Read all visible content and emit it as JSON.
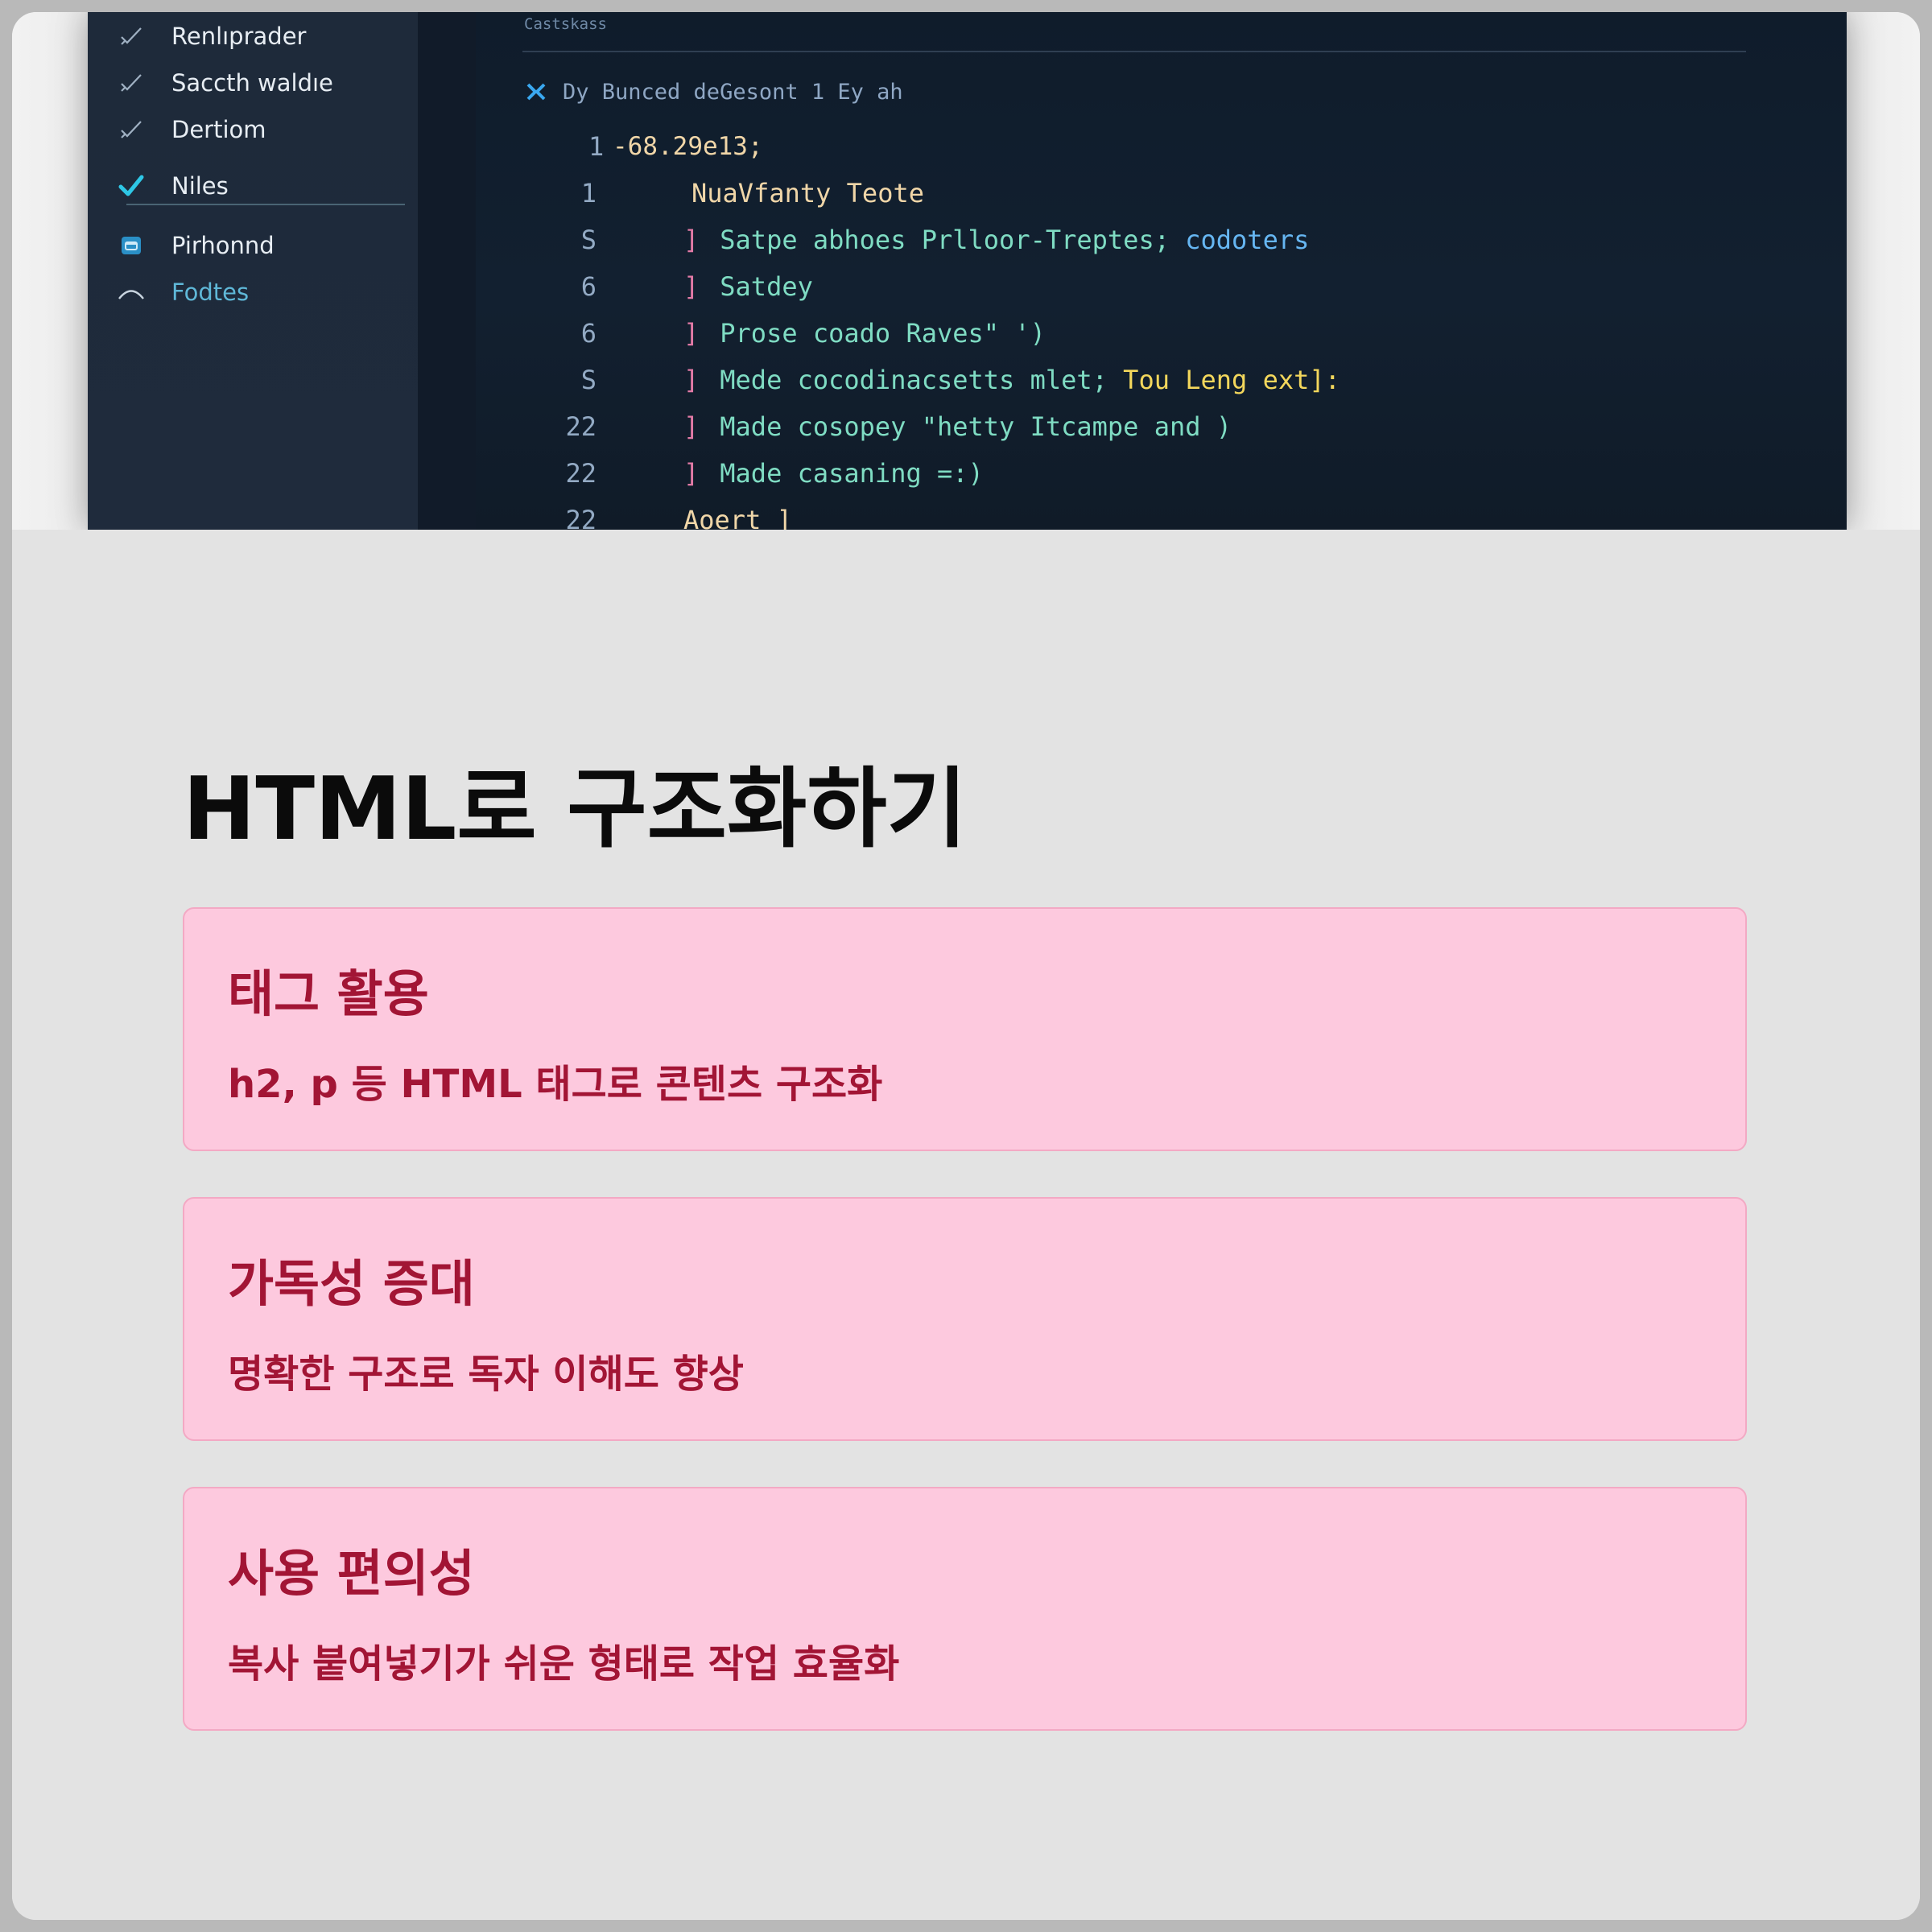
{
  "editor": {
    "pane_header": "Castskass",
    "breadcrumb": "Dy  Bunced deGesont 1  Ey ah",
    "sidebar": {
      "items": [
        {
          "label": "Renlıprader",
          "icon": "check-thin-icon"
        },
        {
          "label": "Saccth waldıe",
          "icon": "check-thin-icon"
        },
        {
          "label": "Dertiom",
          "icon": "check-thin-icon"
        },
        {
          "label": "Niles",
          "icon": "check-bold-icon"
        },
        {
          "label": "Pirhonnd",
          "icon": "window-icon"
        },
        {
          "label": "Fodtes",
          "icon": "chevron-up-icon"
        }
      ]
    },
    "code_lines": [
      {
        "num": "1",
        "text": "-68.29e13;"
      },
      {
        "num": "1",
        "text": "NuaVfanty Teote"
      },
      {
        "num": "S",
        "text": "Satpe abhoes Prlloor-Treptes;",
        "extra": "codoters"
      },
      {
        "num": "6",
        "text": "Satdey"
      },
      {
        "num": "6",
        "text": "Prose coado Raves\" ')"
      },
      {
        "num": "S",
        "text": "Mede cocodinacsetts mlet;",
        "extra": "Tou Leng ext]:"
      },
      {
        "num": "22",
        "text": "Made cosopey \"hetty Itcampe and )"
      },
      {
        "num": "22",
        "text": "Made casaning =:)"
      },
      {
        "num": "22",
        "text": "Aoert ]"
      }
    ]
  },
  "page": {
    "title": "HTML로 구조화하기",
    "cards": [
      {
        "title": "태그 활용",
        "desc": "h2, p 등 HTML 태그로 콘텐츠 구조화"
      },
      {
        "title": "가독성 증대",
        "desc": "명확한 구조로 독자 이해도 향상"
      },
      {
        "title": "사용 편의성",
        "desc": "복사 붙여넣기가 쉬운 형태로 작업 효율화"
      }
    ]
  },
  "colors": {
    "card_bg": "#fdc9de",
    "card_text": "#a21535",
    "page_bg": "#e3e3e3",
    "editor_bg": "#0d1826"
  }
}
